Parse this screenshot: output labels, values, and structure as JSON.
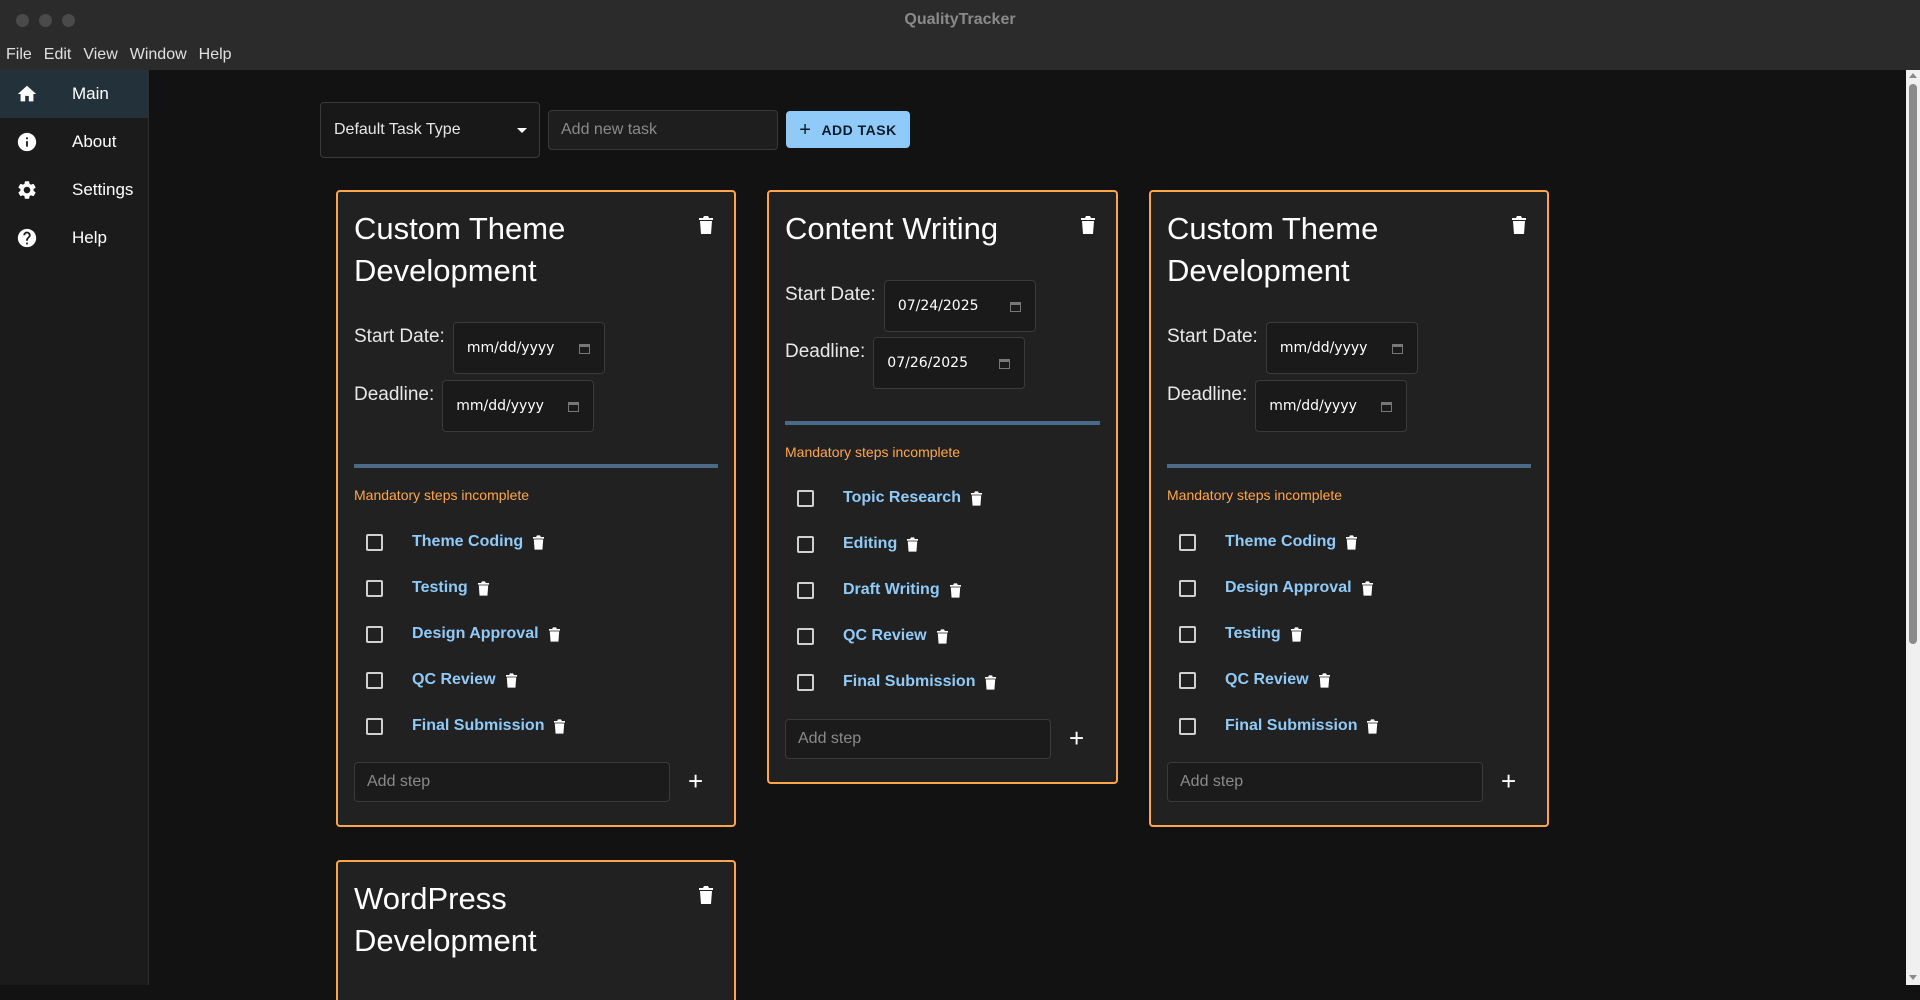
{
  "window": {
    "title": "QualityTracker"
  },
  "menu": [
    "File",
    "Edit",
    "View",
    "Window",
    "Help"
  ],
  "sidebar": {
    "items": [
      {
        "label": "Main",
        "icon": "home-icon",
        "active": true
      },
      {
        "label": "About",
        "icon": "info-icon",
        "active": false
      },
      {
        "label": "Settings",
        "icon": "gear-icon",
        "active": false
      },
      {
        "label": "Help",
        "icon": "help-icon",
        "active": false
      }
    ]
  },
  "toolbar": {
    "task_type": "Default Task Type",
    "new_task_placeholder": "Add new task",
    "add_task_label": "ADD TASK",
    "add_task_icon": "+"
  },
  "labels": {
    "start_date": "Start Date:",
    "deadline": "Deadline:",
    "warning": "Mandatory steps incomplete",
    "add_step_placeholder": "Add step",
    "add_step_icon": "+"
  },
  "cards": [
    {
      "title_line1": "Custom Theme",
      "title_line2": "Development",
      "start_date": "mm/dd/yyyy",
      "deadline": "mm/dd/yyyy",
      "steps": [
        "Theme Coding",
        "Testing",
        "Design Approval",
        "QC Review",
        "Final Submission"
      ]
    },
    {
      "title_line1": "Content Writing",
      "title_line2": "",
      "start_date": "07/24/2025",
      "deadline": "07/26/2025",
      "steps": [
        "Topic Research",
        "Editing",
        "Draft Writing",
        "QC Review",
        "Final Submission"
      ]
    },
    {
      "title_line1": "Custom Theme",
      "title_line2": "Development",
      "start_date": "mm/dd/yyyy",
      "deadline": "mm/dd/yyyy",
      "steps": [
        "Theme Coding",
        "Design Approval",
        "Testing",
        "QC Review",
        "Final Submission"
      ]
    },
    {
      "title_line1": "WordPress",
      "title_line2": "Development"
    }
  ],
  "colors": {
    "accent": "#90caf9",
    "card_border": "#ffa64d",
    "warning": "#ffa64d",
    "divider": "#4b6a88"
  }
}
